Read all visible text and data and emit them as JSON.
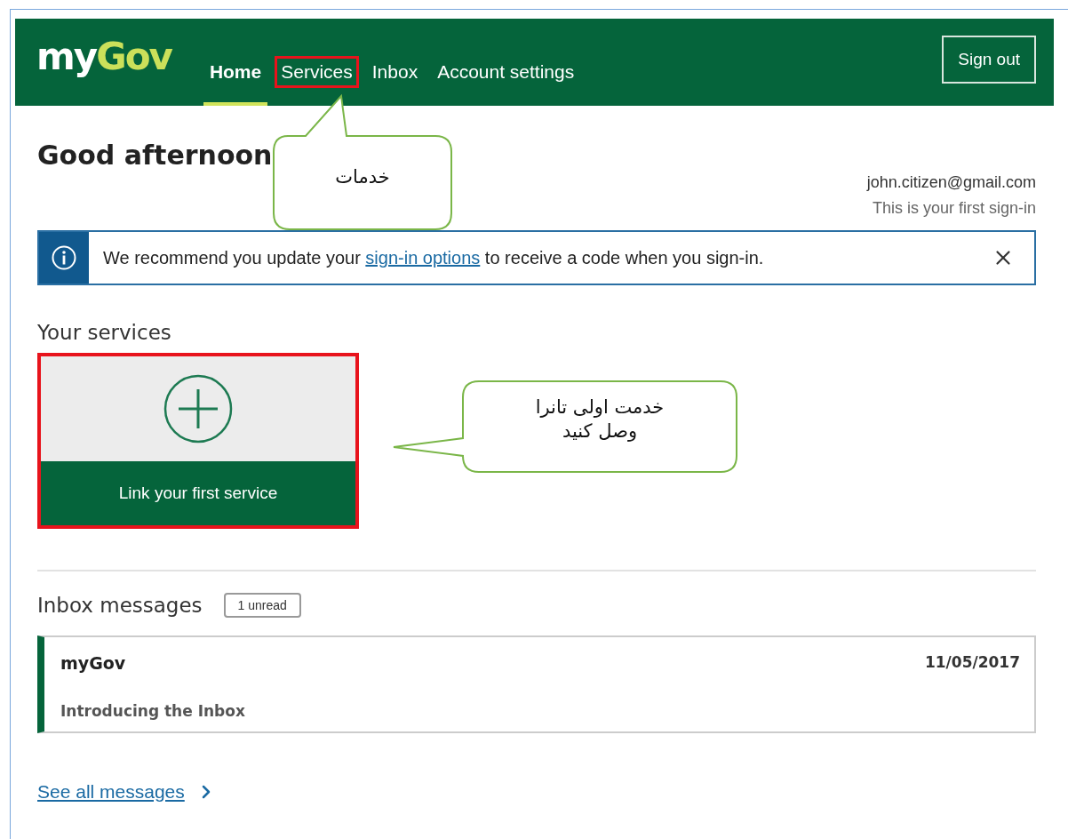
{
  "header": {
    "logo": {
      "first": "my",
      "second": "Gov"
    },
    "nav": [
      {
        "label": "Home",
        "selected": true,
        "highlighted": false
      },
      {
        "label": "Services",
        "selected": false,
        "highlighted": true
      },
      {
        "label": "Inbox",
        "selected": false,
        "highlighted": false
      },
      {
        "label": "Account settings",
        "selected": false,
        "highlighted": false
      }
    ],
    "sign_out": "Sign out"
  },
  "greeting": "Good afternoon",
  "account": {
    "email": "john.citizen@gmail.com",
    "note": "This is your first sign-in"
  },
  "alert": {
    "before": "We recommend you update your ",
    "link": "sign-in options",
    "after": " to receive a code when you sign-in."
  },
  "services": {
    "heading": "Your services",
    "tiles": [
      {
        "label": "Link your first service",
        "highlighted": true
      }
    ]
  },
  "inbox": {
    "heading": "Inbox messages",
    "badge": "1 unread",
    "messages": [
      {
        "sender": "myGov",
        "subject": "Introducing the Inbox",
        "date": "11/05/2017",
        "unread": true
      }
    ],
    "see_all": "See all messages"
  },
  "annotations": [
    {
      "text": "خدمات",
      "kind": "up"
    },
    {
      "text": "خدمت اولی تانرا\nوصل کنید",
      "kind": "left"
    }
  ]
}
